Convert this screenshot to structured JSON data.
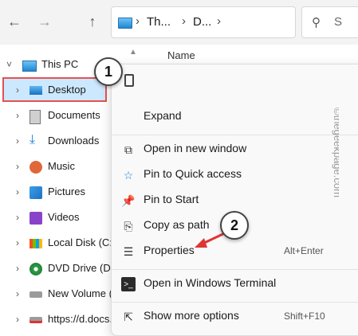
{
  "address": {
    "segments": [
      "Th...",
      "D..."
    ]
  },
  "search": {
    "placeholder": "S"
  },
  "nav": {
    "this_pc": "This PC",
    "items": [
      {
        "label": "Desktop"
      },
      {
        "label": "Documents"
      },
      {
        "label": "Downloads"
      },
      {
        "label": "Music"
      },
      {
        "label": "Pictures"
      },
      {
        "label": "Videos"
      },
      {
        "label": "Local Disk (C:)"
      },
      {
        "label": "DVD Drive (D:)"
      },
      {
        "label": "New Volume (E"
      },
      {
        "label": "https://d.docs."
      }
    ]
  },
  "column_header": "Name",
  "context_menu": {
    "items": [
      {
        "label": "Expand",
        "shortcut": ""
      },
      {
        "label": "Open in new window",
        "shortcut": ""
      },
      {
        "label": "Pin to Quick access",
        "shortcut": ""
      },
      {
        "label": "Pin to Start",
        "shortcut": ""
      },
      {
        "label": "Copy as path",
        "shortcut": ""
      },
      {
        "label": "Properties",
        "shortcut": "Alt+Enter"
      },
      {
        "label": "Open in Windows Terminal",
        "shortcut": ""
      },
      {
        "label": "Show more options",
        "shortcut": "Shift+F10"
      }
    ]
  },
  "badges": [
    "1",
    "2"
  ],
  "watermark": "©thegeekpage.com",
  "colors": {
    "accent": "#cce8ff",
    "highlight_border": "#e55151",
    "arrow": "#e03535"
  }
}
